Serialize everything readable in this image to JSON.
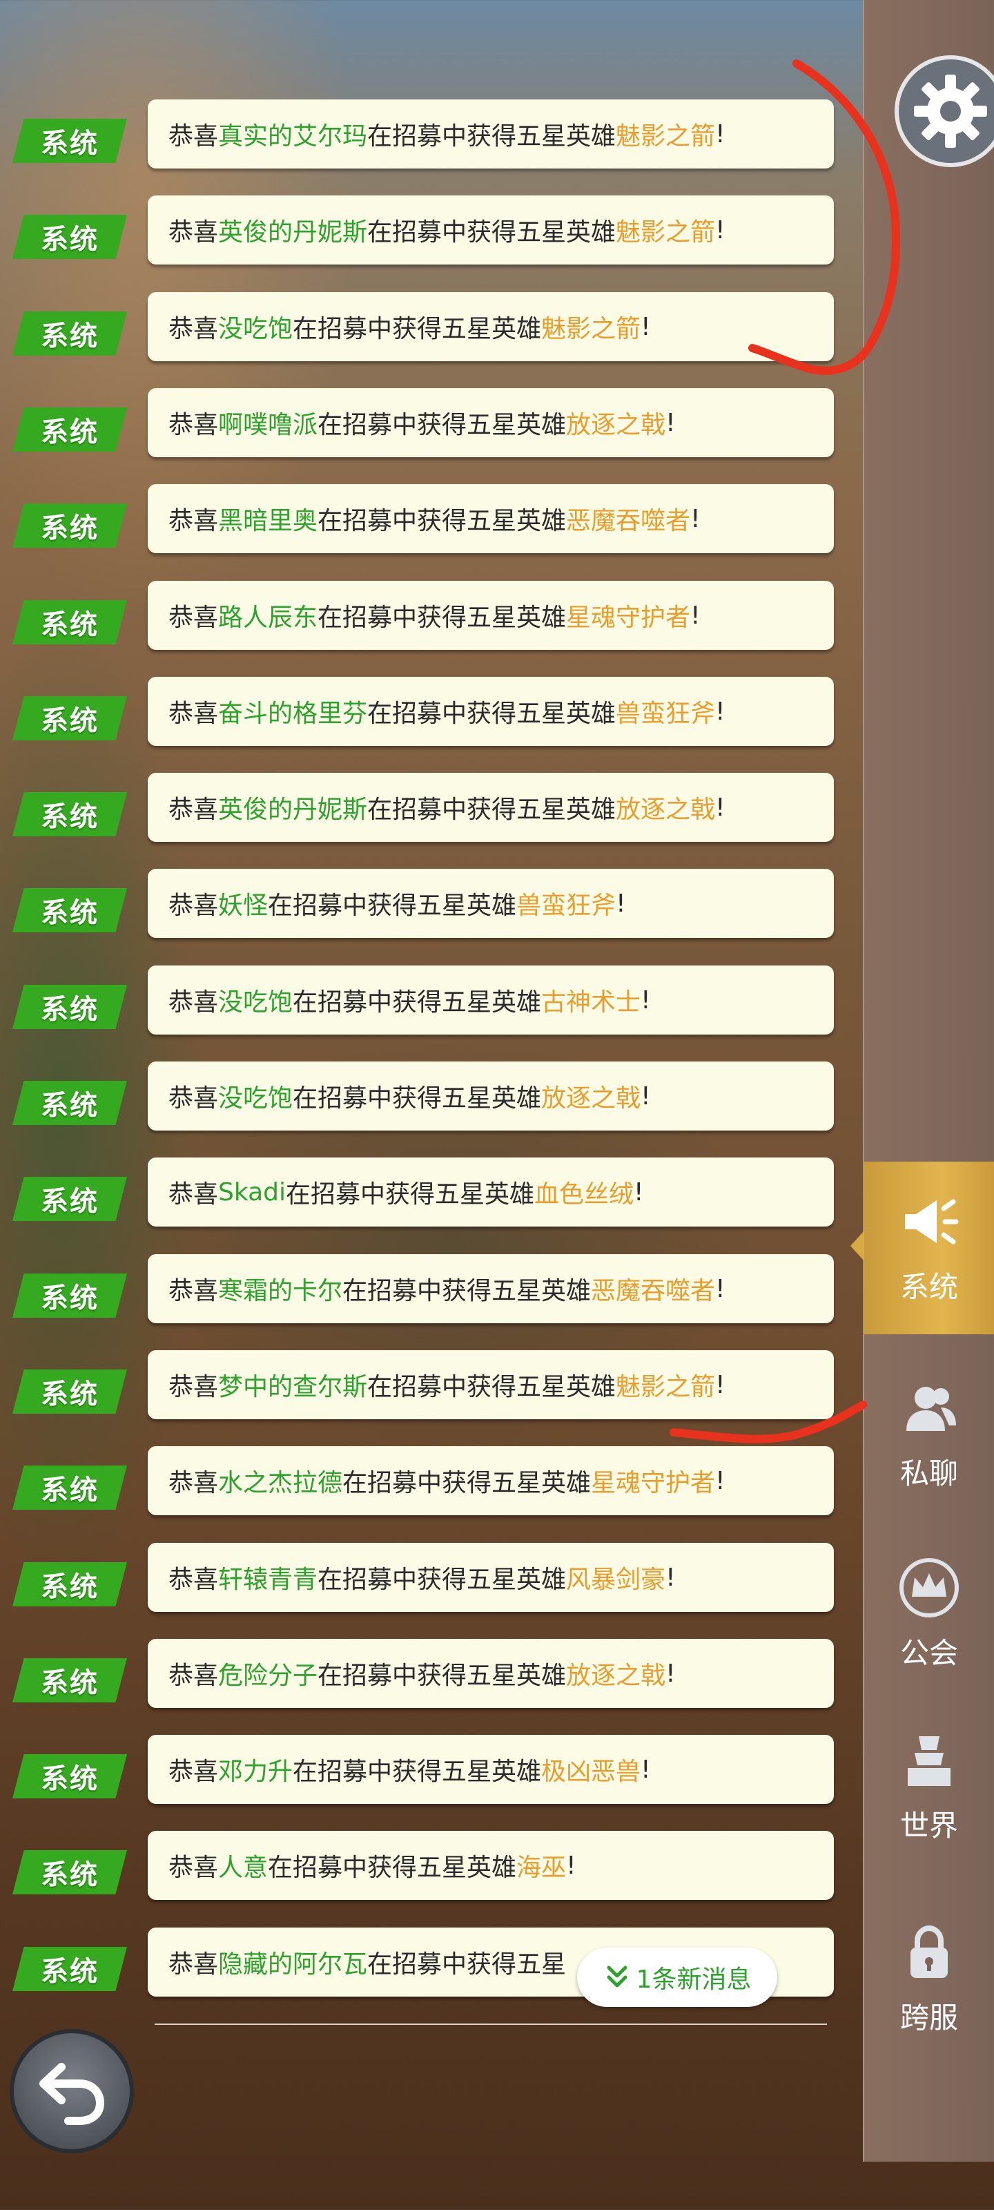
{
  "colors": {
    "system_tag": "#35a91f",
    "bubble_bg": "#fbfbe6",
    "player_name": "#2fa12f",
    "hero_name": "#e89e2e",
    "active_tab": "#d9a944",
    "marker_red": "#e8321e"
  },
  "messages": [
    {
      "tag": "系统",
      "prefix": "恭喜",
      "name": "真实的艾尔玛",
      "middle": "在招募中获得五星英雄",
      "hero": "魅影之箭",
      "suffix": "!"
    },
    {
      "tag": "系统",
      "prefix": "恭喜",
      "name": "英俊的丹妮斯",
      "middle": "在招募中获得五星英雄",
      "hero": "魅影之箭",
      "suffix": "!"
    },
    {
      "tag": "系统",
      "prefix": "恭喜",
      "name": "没吃饱",
      "middle": "在招募中获得五星英雄",
      "hero": "魅影之箭",
      "suffix": "!"
    },
    {
      "tag": "系统",
      "prefix": "恭喜",
      "name": "啊噗噜派",
      "middle": "在招募中获得五星英雄",
      "hero": "放逐之戟",
      "suffix": "!"
    },
    {
      "tag": "系统",
      "prefix": "恭喜",
      "name": "黑暗里奥",
      "middle": "在招募中获得五星英雄",
      "hero": "恶魔吞噬者",
      "suffix": "!"
    },
    {
      "tag": "系统",
      "prefix": "恭喜",
      "name": "路人辰东",
      "middle": "在招募中获得五星英雄",
      "hero": "星魂守护者",
      "suffix": "!"
    },
    {
      "tag": "系统",
      "prefix": "恭喜",
      "name": "奋斗的格里芬",
      "middle": "在招募中获得五星英雄",
      "hero": "兽蛮狂斧",
      "suffix": "!"
    },
    {
      "tag": "系统",
      "prefix": "恭喜",
      "name": "英俊的丹妮斯",
      "middle": "在招募中获得五星英雄",
      "hero": "放逐之戟",
      "suffix": "!"
    },
    {
      "tag": "系统",
      "prefix": "恭喜",
      "name": "妖怪",
      "middle": "在招募中获得五星英雄",
      "hero": "兽蛮狂斧",
      "suffix": "!"
    },
    {
      "tag": "系统",
      "prefix": "恭喜",
      "name": "没吃饱",
      "middle": "在招募中获得五星英雄",
      "hero": "古神术士",
      "suffix": "!"
    },
    {
      "tag": "系统",
      "prefix": "恭喜",
      "name": "没吃饱",
      "middle": "在招募中获得五星英雄",
      "hero": "放逐之戟",
      "suffix": "!"
    },
    {
      "tag": "系统",
      "prefix": "恭喜",
      "name": "Skadi",
      "middle": "在招募中获得五星英雄",
      "hero": "血色丝绒",
      "suffix": "!"
    },
    {
      "tag": "系统",
      "prefix": "恭喜",
      "name": "寒霜的卡尔",
      "middle": "在招募中获得五星英雄",
      "hero": "恶魔吞噬者",
      "suffix": "!"
    },
    {
      "tag": "系统",
      "prefix": "恭喜",
      "name": "梦中的查尔斯",
      "middle": "在招募中获得五星英雄",
      "hero": "魅影之箭",
      "suffix": "!"
    },
    {
      "tag": "系统",
      "prefix": "恭喜",
      "name": "水之杰拉德",
      "middle": "在招募中获得五星英雄",
      "hero": "星魂守护者",
      "suffix": "!"
    },
    {
      "tag": "系统",
      "prefix": "恭喜",
      "name": "轩辕青青",
      "middle": "在招募中获得五星英雄",
      "hero": "风暴剑豪",
      "suffix": "!"
    },
    {
      "tag": "系统",
      "prefix": "恭喜",
      "name": "危险分子",
      "middle": "在招募中获得五星英雄",
      "hero": "放逐之戟",
      "suffix": "!"
    },
    {
      "tag": "系统",
      "prefix": "恭喜",
      "name": "邓力升",
      "middle": "在招募中获得五星英雄",
      "hero": "极凶恶兽",
      "suffix": "!"
    },
    {
      "tag": "系统",
      "prefix": "恭喜",
      "name": "人意",
      "middle": "在招募中获得五星英雄",
      "hero": "海巫",
      "suffix": "!"
    },
    {
      "tag": "系统",
      "prefix": "恭喜",
      "name": "隐藏的阿尔瓦",
      "middle": "在招募中获得五星",
      "hero": "",
      "suffix": ""
    }
  ],
  "new_message": {
    "label": "1条新消息",
    "icon": "double-chevron-down-icon"
  },
  "back_button": {
    "icon": "return-arrow-icon"
  },
  "settings_button": {
    "icon": "gear-icon"
  },
  "tabs": [
    {
      "label": "系统",
      "icon": "megaphone-icon",
      "active": true
    },
    {
      "label": "私聊",
      "icon": "people-icon",
      "active": false
    },
    {
      "label": "公会",
      "icon": "crown-icon",
      "active": false
    },
    {
      "label": "世界",
      "icon": "tower-icon",
      "active": false
    },
    {
      "label": "跨服",
      "icon": "lock-icon",
      "active": false
    }
  ]
}
